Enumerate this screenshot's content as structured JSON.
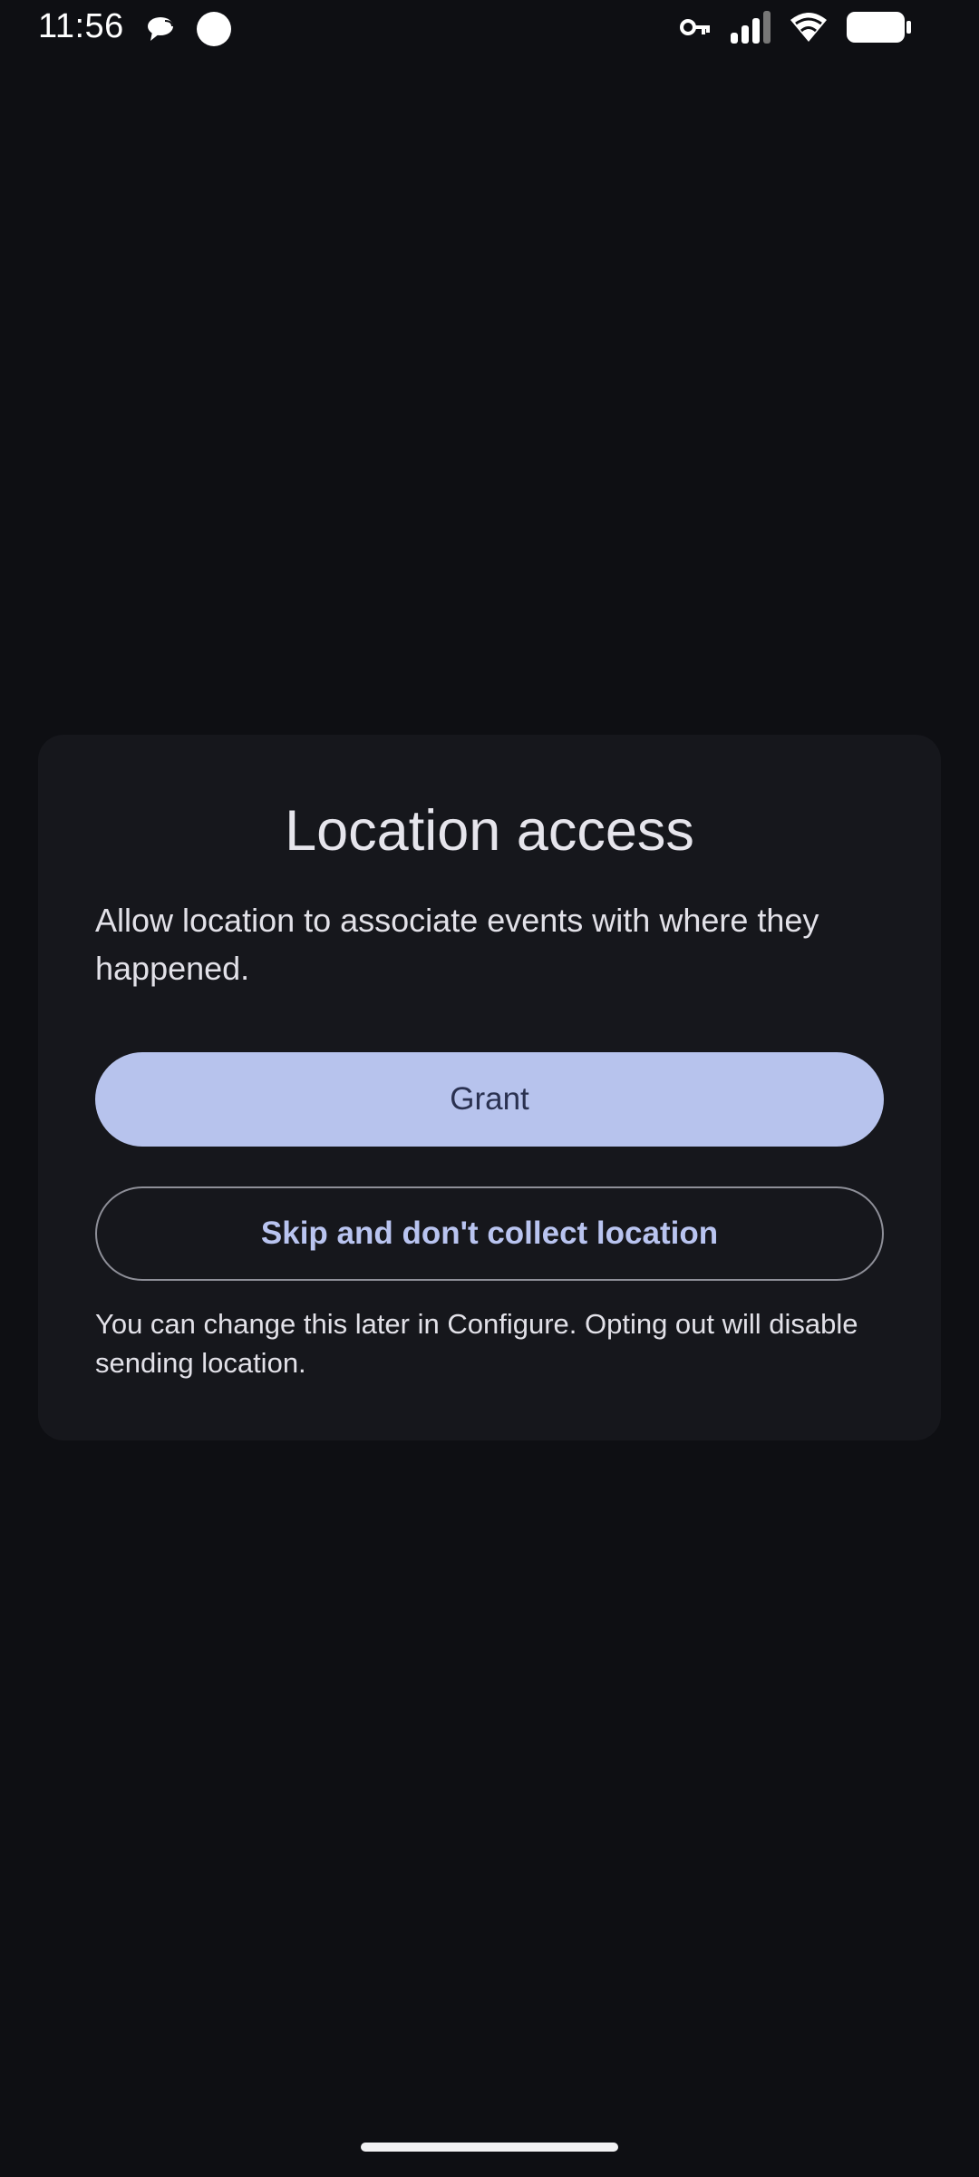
{
  "status_bar": {
    "time": "11:56",
    "left_icons": [
      "chat-bubble-icon",
      "circle-icon"
    ],
    "right_icons": [
      "key-icon",
      "signal-icon",
      "wifi-icon",
      "battery-icon"
    ]
  },
  "dialog": {
    "title": "Location access",
    "message": "Allow location to associate events with where they happened.",
    "primary_button": "Grant",
    "secondary_button": "Skip and don't collect location",
    "footnote": "You can change this later in Configure. Opting out will disable sending location."
  },
  "colors": {
    "background": "#0e0f13",
    "card": "#16171c",
    "primary_button": "#b7c3ed",
    "primary_button_text": "#2a3150",
    "outline_button_text": "#b9c4f0"
  }
}
